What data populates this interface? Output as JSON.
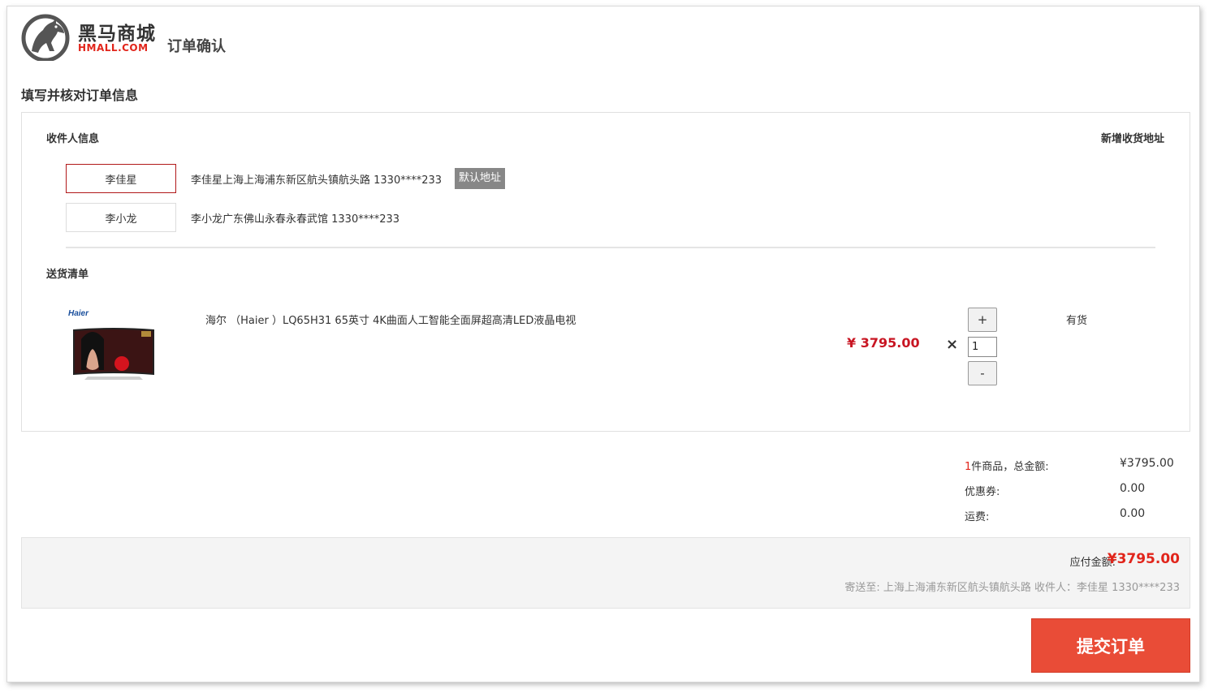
{
  "header": {
    "brand_cn": "黑马商城",
    "brand_en": "HMALL.COM",
    "page_title": "订单确认"
  },
  "section_title": "填写并核对订单信息",
  "receiver": {
    "label": "收件人信息",
    "add_address": "新增收货地址",
    "addresses": [
      {
        "name": "李佳星",
        "detail": "李佳星上海上海浦东新区航头镇航头路 1330****233",
        "badge": "默认地址",
        "selected": true
      },
      {
        "name": "李小龙",
        "detail": "李小龙广东佛山永春永春武馆 1330****233",
        "selected": false
      }
    ]
  },
  "delivery": {
    "label": "送货清单",
    "product": {
      "brand_logo": "Haier",
      "name": "海尔 （Haier ）LQ65H31 65英寸 4K曲面人工智能全面屏超高清LED液晶电视",
      "price": "¥ 3795.00",
      "times": "×",
      "qty_plus": "+",
      "qty": "1",
      "qty_minus": "-",
      "stock": "有货"
    }
  },
  "summary": {
    "count": "1",
    "count_label": "件商品，总金额:",
    "total": "¥3795.00",
    "coupon_label": "优惠券:",
    "coupon": "0.00",
    "freight_label": "运费:",
    "freight": "0.00"
  },
  "payment": {
    "label": "应付金额:",
    "amount": "¥3795.00",
    "ship_to": "寄送至: 上海上海浦东新区航头镇航头路 收件人：李佳星 1330****233"
  },
  "submit_label": "提交订单",
  "colors": {
    "accent_red": "#e1251b",
    "submit_bg": "#e94c37",
    "selected_border": "#b1191a",
    "badge_bg": "#878787"
  }
}
